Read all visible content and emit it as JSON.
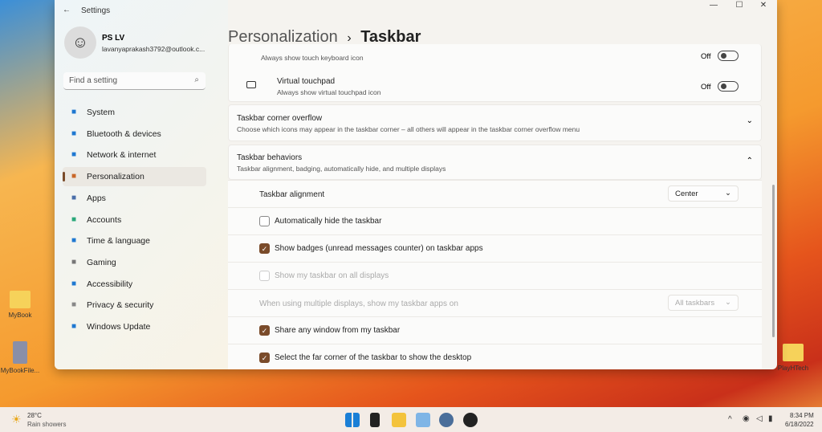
{
  "window": {
    "title": "Settings",
    "controls": [
      "—",
      "☐",
      "✕"
    ]
  },
  "user": {
    "name": "PS LV",
    "email": "lavanyaprakash3792@outlook.c..."
  },
  "search": {
    "placeholder": "Find a setting"
  },
  "sidebar": {
    "items": [
      {
        "label": "System",
        "icon": "monitor-icon",
        "color": "#1f78d1"
      },
      {
        "label": "Bluetooth & devices",
        "icon": "bluetooth-icon",
        "color": "#1f78d1"
      },
      {
        "label": "Network & internet",
        "icon": "wifi-icon",
        "color": "#1f78d1"
      },
      {
        "label": "Personalization",
        "icon": "brush-icon",
        "color": "#c9682a",
        "active": true
      },
      {
        "label": "Apps",
        "icon": "apps-icon",
        "color": "#4a6ea9"
      },
      {
        "label": "Accounts",
        "icon": "person-icon",
        "color": "#2aa87a"
      },
      {
        "label": "Time & language",
        "icon": "globe-icon",
        "color": "#1f78d1"
      },
      {
        "label": "Gaming",
        "icon": "controller-icon",
        "color": "#777"
      },
      {
        "label": "Accessibility",
        "icon": "accessibility-icon",
        "color": "#1f78d1"
      },
      {
        "label": "Privacy & security",
        "icon": "shield-icon",
        "color": "#888"
      },
      {
        "label": "Windows Update",
        "icon": "update-icon",
        "color": "#1f78d1"
      }
    ]
  },
  "breadcrumb": {
    "parent": "Personalization",
    "sep": "›",
    "current": "Taskbar"
  },
  "touch_keyboard": {
    "subtitle": "Always show touch keyboard icon",
    "state": "Off"
  },
  "virtual_touchpad": {
    "title": "Virtual touchpad",
    "subtitle": "Always show virtual touchpad icon",
    "state": "Off"
  },
  "corner_overflow": {
    "title": "Taskbar corner overflow",
    "subtitle": "Choose which icons may appear in the taskbar corner – all others will appear in the taskbar corner overflow menu"
  },
  "behaviors": {
    "title": "Taskbar behaviors",
    "subtitle": "Taskbar alignment, badging, automatically hide, and multiple displays",
    "alignment_label": "Taskbar alignment",
    "alignment_value": "Center",
    "auto_hide": {
      "label": "Automatically hide the taskbar",
      "checked": false
    },
    "badges": {
      "label": "Show badges (unread messages counter) on taskbar apps",
      "checked": true
    },
    "all_displays": {
      "label": "Show my taskbar on all displays",
      "checked": false,
      "disabled": true
    },
    "multi_label": "When using multiple displays, show my taskbar apps on",
    "multi_value": "All taskbars",
    "share": {
      "label": "Share any window from my taskbar",
      "checked": true
    },
    "far_corner": {
      "label": "Select the far corner of the taskbar to show the desktop",
      "checked": true
    }
  },
  "desktop": {
    "icons": [
      "MyBook",
      "MyBookFile...",
      "PlayHTech"
    ]
  },
  "taskbar": {
    "weather_temp": "28°C",
    "weather_desc": "Rain showers",
    "time": "8:34 PM",
    "date": "6/18/2022"
  },
  "accent": "#7a4b2a"
}
